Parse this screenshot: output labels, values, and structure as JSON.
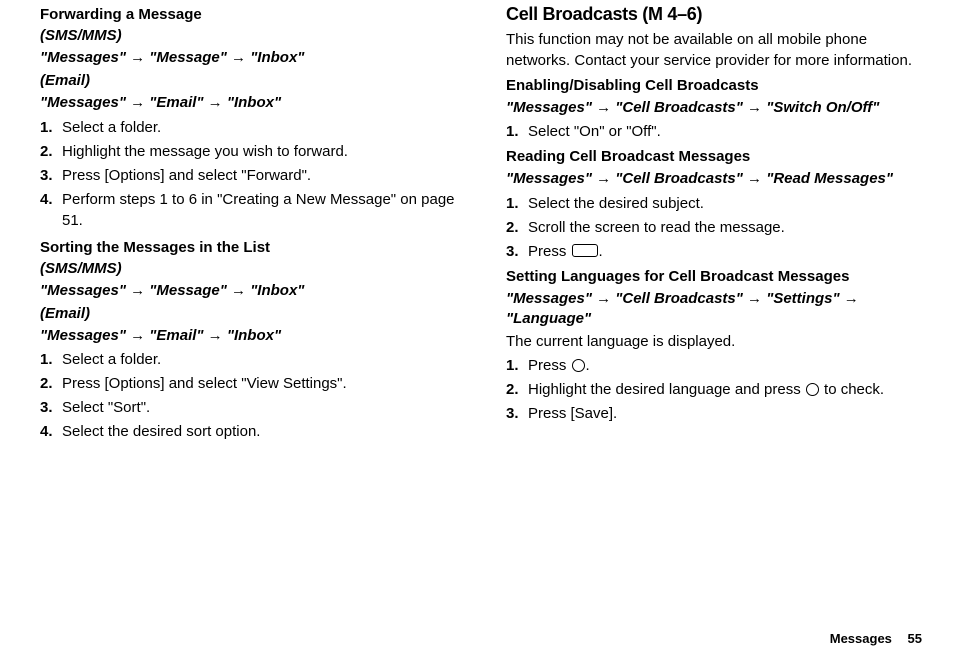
{
  "arrow": "→",
  "left": {
    "forwarding": {
      "title": "Forwarding a Message",
      "sms_label": "(SMS/MMS)",
      "sms_path": "\"Messages\" → \"Message\" → \"Inbox\"",
      "email_label": "(Email)",
      "email_path": "\"Messages\" → \"Email\" → \"Inbox\"",
      "steps": [
        "Select a folder.",
        "Highlight the message you wish to forward.",
        "Press [Options] and select \"Forward\".",
        "Perform steps 1 to 6 in \"Creating a New Message\" on page 51."
      ]
    },
    "sorting": {
      "title": "Sorting the Messages in the List",
      "sms_label": "(SMS/MMS)",
      "sms_path": "\"Messages\" → \"Message\" → \"Inbox\"",
      "email_label": "(Email)",
      "email_path": "\"Messages\" → \"Email\" → \"Inbox\"",
      "steps": [
        "Select a folder.",
        "Press [Options] and select \"View Settings\".",
        "Select \"Sort\".",
        "Select the desired sort option."
      ]
    }
  },
  "right": {
    "cell_broadcasts": {
      "title": "Cell Broadcasts",
      "menu_code": " (M 4–6)",
      "intro": "This function may not be available on all mobile phone networks. Contact your service provider for more information.",
      "enable": {
        "title": "Enabling/Disabling Cell Broadcasts",
        "path": "\"Messages\" → \"Cell Broadcasts\" → \"Switch On/Off\"",
        "steps": [
          "Select \"On\" or \"Off\"."
        ]
      },
      "reading": {
        "title": "Reading Cell Broadcast Messages",
        "path": "\"Messages\" → \"Cell Broadcasts\" → \"Read Messages\"",
        "steps_1": "Select the desired subject.",
        "steps_2": "Scroll the screen to read the message.",
        "steps_3_before": "Press ",
        "steps_3_after": "."
      },
      "languages": {
        "title": "Setting Languages for Cell Broadcast Messages",
        "path": "\"Messages\" → \"Cell Broadcasts\" → \"Settings\" → \"Language\"",
        "intro": "The current language is displayed.",
        "step1_before": "Press ",
        "step1_after": ".",
        "step2_before": "Highlight the desired language and press ",
        "step2_after": " to check.",
        "step3": "Press [Save]."
      }
    }
  },
  "footer": {
    "label": "Messages",
    "page": "55"
  }
}
